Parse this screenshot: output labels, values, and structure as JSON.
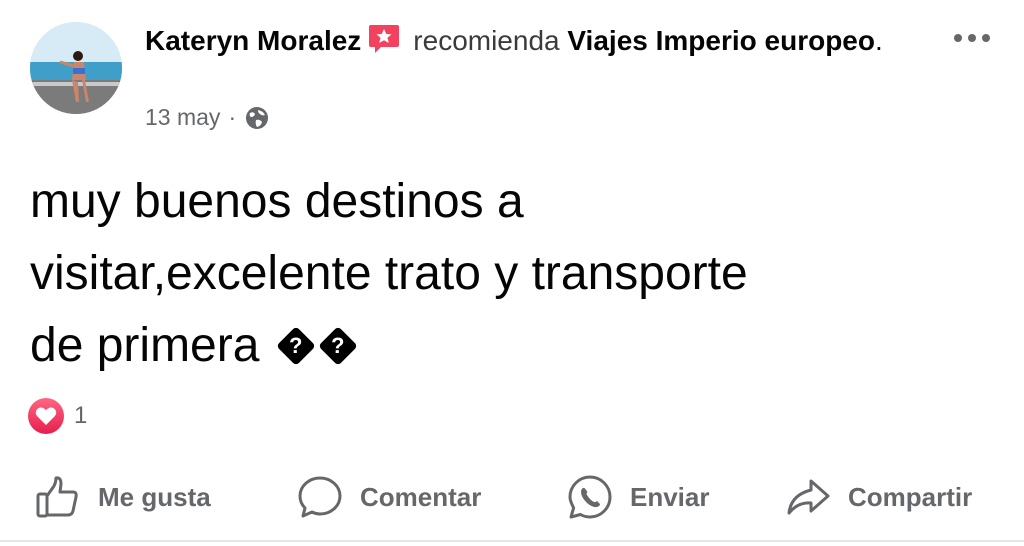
{
  "post": {
    "author": "Kateryn Moralez",
    "recommend_text": "recomienda",
    "page_name": "Viajes Imperio europeo",
    "page_suffix": ".",
    "date": "13 may",
    "separator": "·",
    "privacy_icon": "globe-icon",
    "body_line1": "muy buenos destinos a",
    "body_line2": "visitar,excelente trato y transporte",
    "body_line3": "de primera"
  },
  "reactions": {
    "icon": "heart-icon",
    "count": "1"
  },
  "actions": {
    "like_label": "Me gusta",
    "comment_label": "Comentar",
    "send_label": "Enviar",
    "share_label": "Compartir"
  },
  "colors": {
    "text": "#050505",
    "secondary": "#65676b",
    "recommend_badge": "#f3425f",
    "heart": "#e61e4d"
  }
}
